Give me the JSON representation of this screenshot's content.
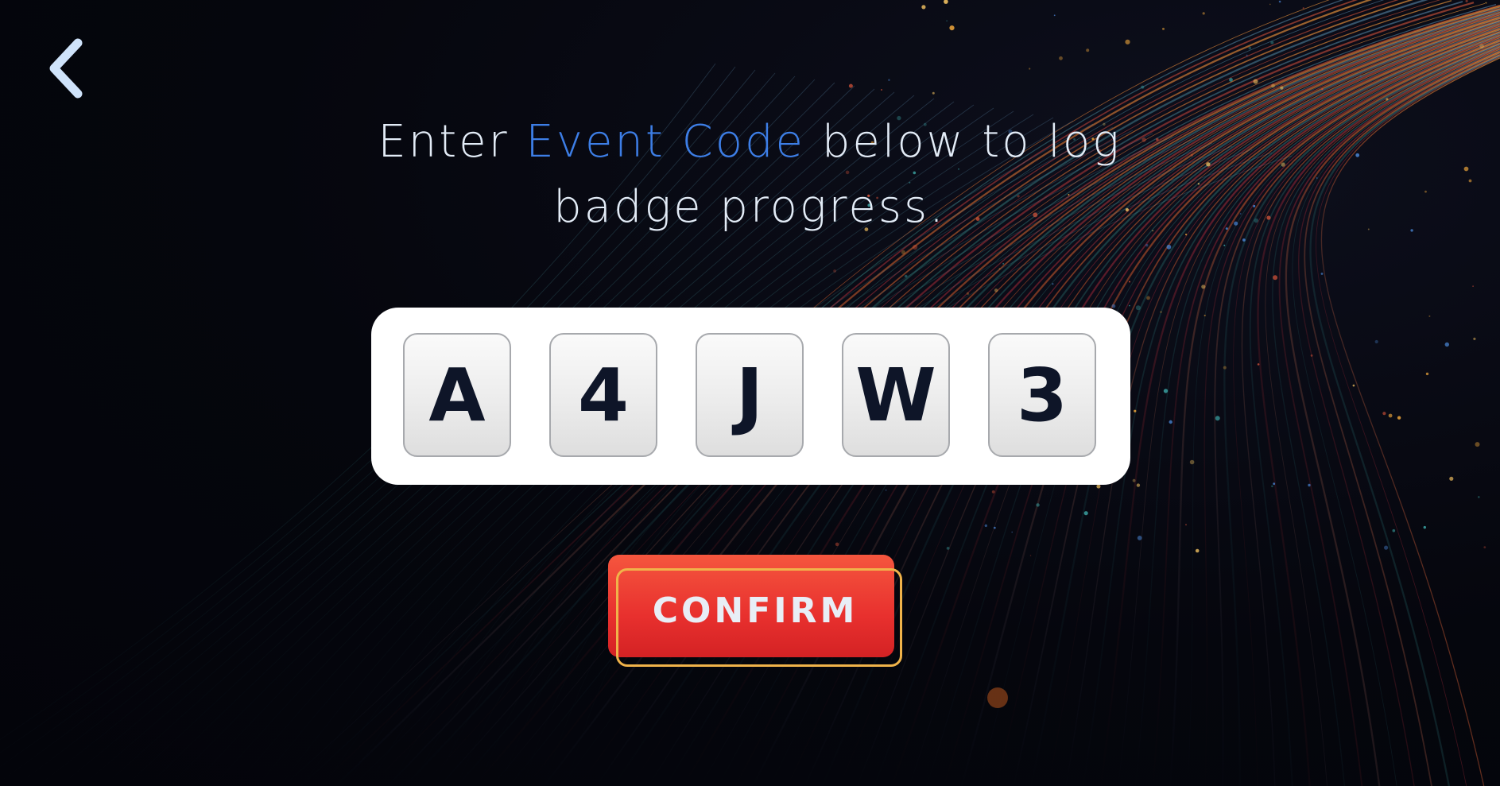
{
  "nav": {
    "back_icon": "chevron-left-icon"
  },
  "headline": {
    "prefix": "Enter ",
    "highlight": "Event Code",
    "suffix": " below to log badge progress."
  },
  "code_entry": {
    "characters": [
      "A",
      "4",
      "J",
      "W",
      "3"
    ]
  },
  "confirm": {
    "label": "CONFIRM"
  },
  "colors": {
    "background": "#05070f",
    "headline_text": "#e3ecf7",
    "accent_blue": "#3d7ee6",
    "panel": "#ffffff",
    "code_text": "#0e1528",
    "button_red": "#e8302e",
    "button_outline": "#f0b34a",
    "button_text": "#e8eef6",
    "back_icon": "#cfe3fb"
  }
}
